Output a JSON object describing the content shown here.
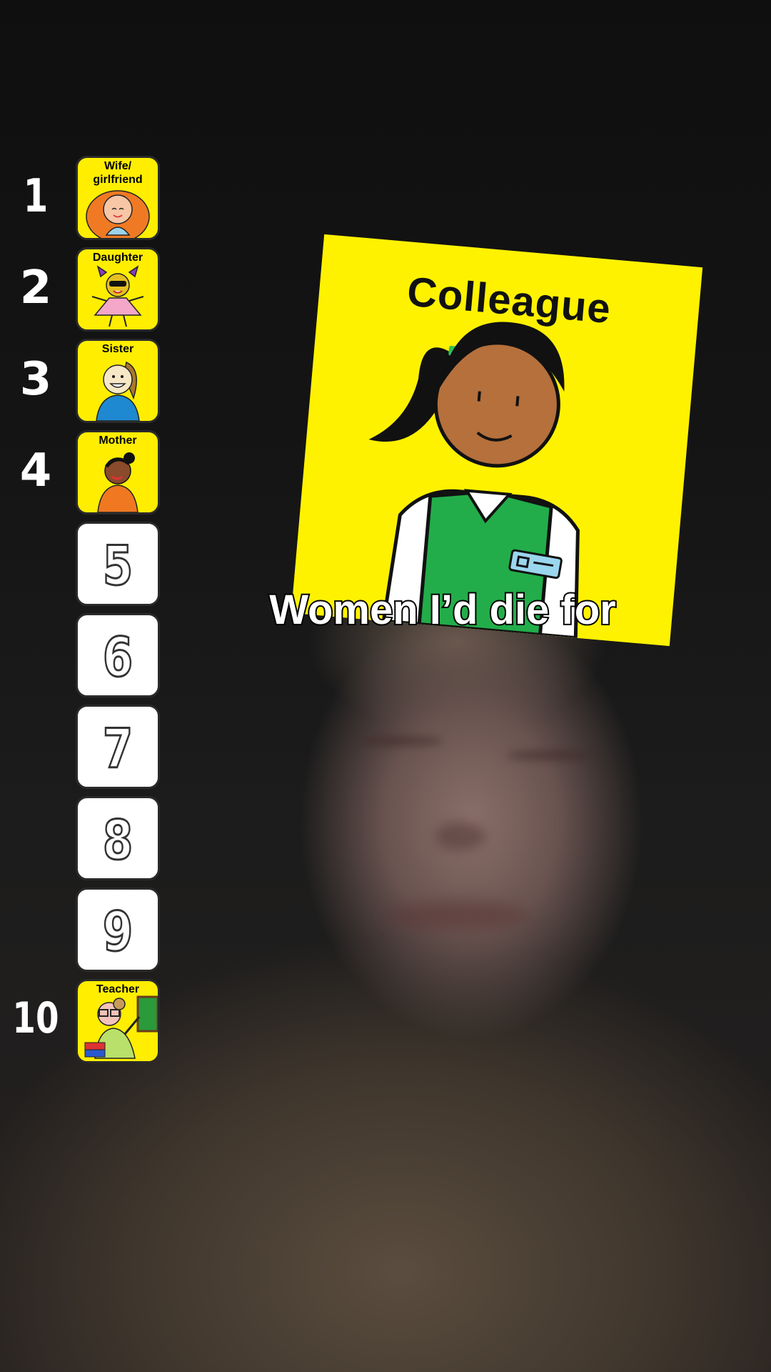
{
  "ranking": [
    {
      "rank": "1",
      "label": "Wife/ girlfriend",
      "filled": true,
      "icon": "wife-girlfriend-illustration"
    },
    {
      "rank": "2",
      "label": "Daughter",
      "filled": true,
      "icon": "daughter-illustration"
    },
    {
      "rank": "3",
      "label": "Sister",
      "filled": true,
      "icon": "sister-illustration"
    },
    {
      "rank": "4",
      "label": "Mother",
      "filled": true,
      "icon": "mother-illustration"
    },
    {
      "rank": "5",
      "label": "",
      "filled": false
    },
    {
      "rank": "6",
      "label": "",
      "filled": false
    },
    {
      "rank": "7",
      "label": "",
      "filled": false
    },
    {
      "rank": "8",
      "label": "",
      "filled": false
    },
    {
      "rank": "9",
      "label": "",
      "filled": false
    },
    {
      "rank": "10",
      "label": "Teacher",
      "filled": true,
      "icon": "teacher-illustration"
    }
  ],
  "current_card": {
    "title": "Colleague",
    "icon": "colleague-illustration",
    "background_color": "#fff200"
  },
  "caption": "Women I’d die for",
  "colors": {
    "card_yellow": "#ffee00",
    "empty_slot": "#ffffff",
    "text_white": "#ffffff"
  }
}
